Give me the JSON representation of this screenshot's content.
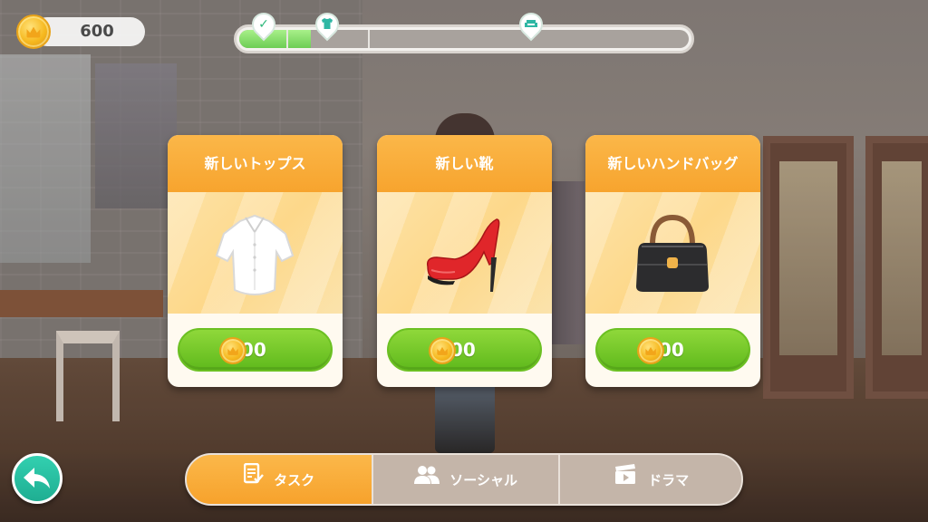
{
  "currency": {
    "coins": "600"
  },
  "progress": {
    "fraction": 0.16,
    "markers": [
      {
        "icon": "checkmark-icon",
        "reached": true
      },
      {
        "icon": "shirt-icon",
        "reached": true
      },
      {
        "icon": "sofa-icon",
        "reached": false
      }
    ]
  },
  "cards": [
    {
      "title": "新しいトップス",
      "item": "white-blouse",
      "price": "100"
    },
    {
      "title": "新しい靴",
      "item": "red-high-heel",
      "price": "200"
    },
    {
      "title": "新しいハンドバッグ",
      "item": "black-handbag",
      "price": "100"
    }
  ],
  "tabs": {
    "task": {
      "label": "タスク",
      "icon": "task-list-icon",
      "active": true
    },
    "social": {
      "label": "ソーシャル",
      "icon": "people-icon",
      "active": false
    },
    "drama": {
      "label": "ドラマ",
      "icon": "clapperboard-icon",
      "active": false
    }
  },
  "colors": {
    "accent_orange": "#f7a42e",
    "button_green": "#6cc023",
    "back_teal": "#26bb9c",
    "progress_green": "#6ccd54"
  }
}
